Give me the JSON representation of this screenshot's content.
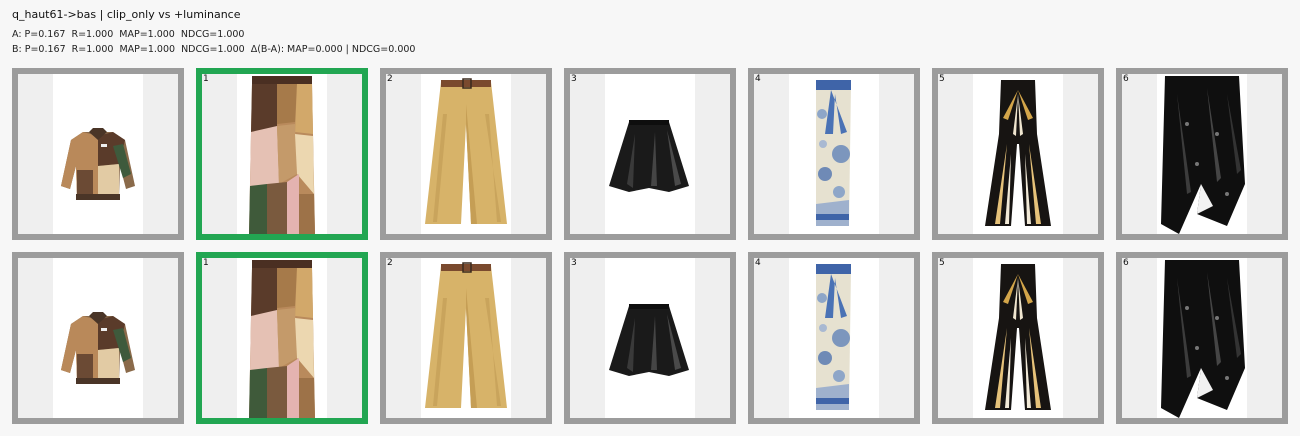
{
  "header": {
    "title": "q_haut61->bas | clip_only vs +luminance",
    "metric_a": "A: P=0.167  R=1.000  MAP=1.000  NDCG=1.000",
    "metric_b": "B: P=0.167  R=1.000  MAP=1.000  NDCG=1.000  Δ(B-A): MAP=0.000 | NDCG=0.000"
  },
  "rows": [
    {
      "label": "A",
      "query": {
        "item": "patchwork jacket"
      },
      "results": [
        {
          "rank": "1",
          "relevant": true,
          "item": "patchwork skirt"
        },
        {
          "rank": "2",
          "relevant": false,
          "item": "camel wide-leg trousers"
        },
        {
          "rank": "3",
          "relevant": false,
          "item": "black leather mini skirt"
        },
        {
          "rank": "4",
          "relevant": false,
          "item": "blue toile wrap skirt"
        },
        {
          "rank": "5",
          "relevant": false,
          "item": "striped flared trousers"
        },
        {
          "rank": "6",
          "relevant": false,
          "item": "black sequin skirt"
        }
      ]
    },
    {
      "label": "B",
      "query": {
        "item": "patchwork jacket"
      },
      "results": [
        {
          "rank": "1",
          "relevant": true,
          "item": "patchwork skirt"
        },
        {
          "rank": "2",
          "relevant": false,
          "item": "camel wide-leg trousers"
        },
        {
          "rank": "3",
          "relevant": false,
          "item": "black leather mini skirt"
        },
        {
          "rank": "4",
          "relevant": false,
          "item": "blue toile wrap skirt"
        },
        {
          "rank": "5",
          "relevant": false,
          "item": "striped flared trousers"
        },
        {
          "rank": "6",
          "relevant": false,
          "item": "black sequin skirt"
        }
      ]
    }
  ],
  "colors": {
    "relevant_border": "#22a652",
    "default_border": "#9c9c9c",
    "tile_background": "#efefef"
  }
}
